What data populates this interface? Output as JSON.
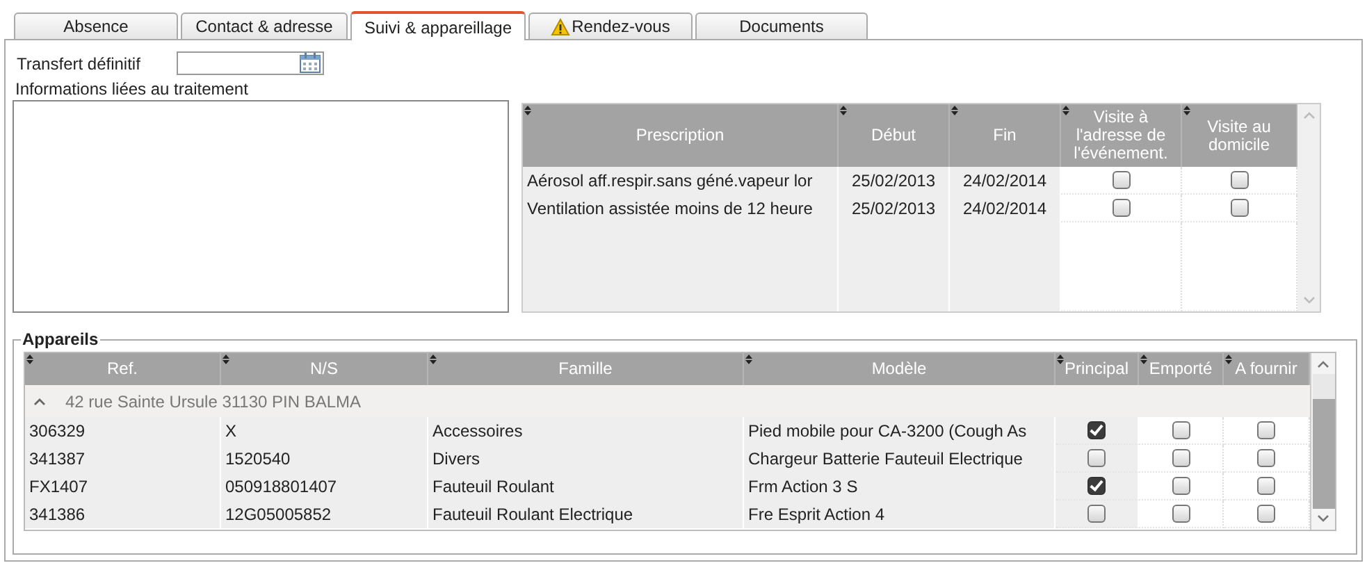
{
  "tabs": [
    {
      "label": "Absence",
      "selected": false,
      "warning": false
    },
    {
      "label": "Contact & adresse",
      "selected": false,
      "warning": false
    },
    {
      "label": "Suivi & appareillage",
      "selected": true,
      "warning": false
    },
    {
      "label": "Rendez-vous",
      "selected": false,
      "warning": true
    },
    {
      "label": "Documents",
      "selected": false,
      "warning": false
    }
  ],
  "transfer": {
    "label": "Transfert définitif"
  },
  "treatment": {
    "label": "Informations liées au traitement"
  },
  "prescriptions": {
    "columns": [
      "Prescription",
      "Début",
      "Fin",
      "Visite à l'adresse de l'événement.",
      "Visite au domicile"
    ],
    "rows": [
      {
        "prescription": "Aérosol aff.respir.sans géné.vapeur lor",
        "debut": "25/02/2013",
        "fin": "24/02/2014",
        "visite_adresse": false,
        "visite_domicile": false
      },
      {
        "prescription": "Ventilation assistée moins de 12 heure",
        "debut": "25/02/2013",
        "fin": "24/02/2014",
        "visite_adresse": false,
        "visite_domicile": false
      }
    ]
  },
  "appareils": {
    "title": "Appareils",
    "columns": [
      "Ref.",
      "N/S",
      "Famille",
      "Modèle",
      "Principal",
      "Emporté",
      "A fournir"
    ],
    "group": {
      "label": "42 rue Sainte Ursule 31130 PIN BALMA",
      "expanded": true
    },
    "rows": [
      {
        "ref": "306329",
        "ns": "X",
        "famille": "Accessoires",
        "modele": "Pied mobile pour CA-3200 (Cough As",
        "principal": true,
        "emporte": false,
        "a_fournir": false
      },
      {
        "ref": "341387",
        "ns": "1520540",
        "famille": "Divers",
        "modele": "Chargeur Batterie Fauteuil Electrique",
        "principal": false,
        "emporte": false,
        "a_fournir": false
      },
      {
        "ref": "FX1407",
        "ns": "050918801407",
        "famille": "Fauteuil Roulant",
        "modele": "Frm Action 3 S",
        "principal": true,
        "emporte": false,
        "a_fournir": false
      },
      {
        "ref": "341386",
        "ns": "12G05005852",
        "famille": "Fauteuil Roulant Electrique",
        "modele": "Fre Esprit Action 4",
        "principal": false,
        "emporte": false,
        "a_fournir": false
      }
    ]
  }
}
